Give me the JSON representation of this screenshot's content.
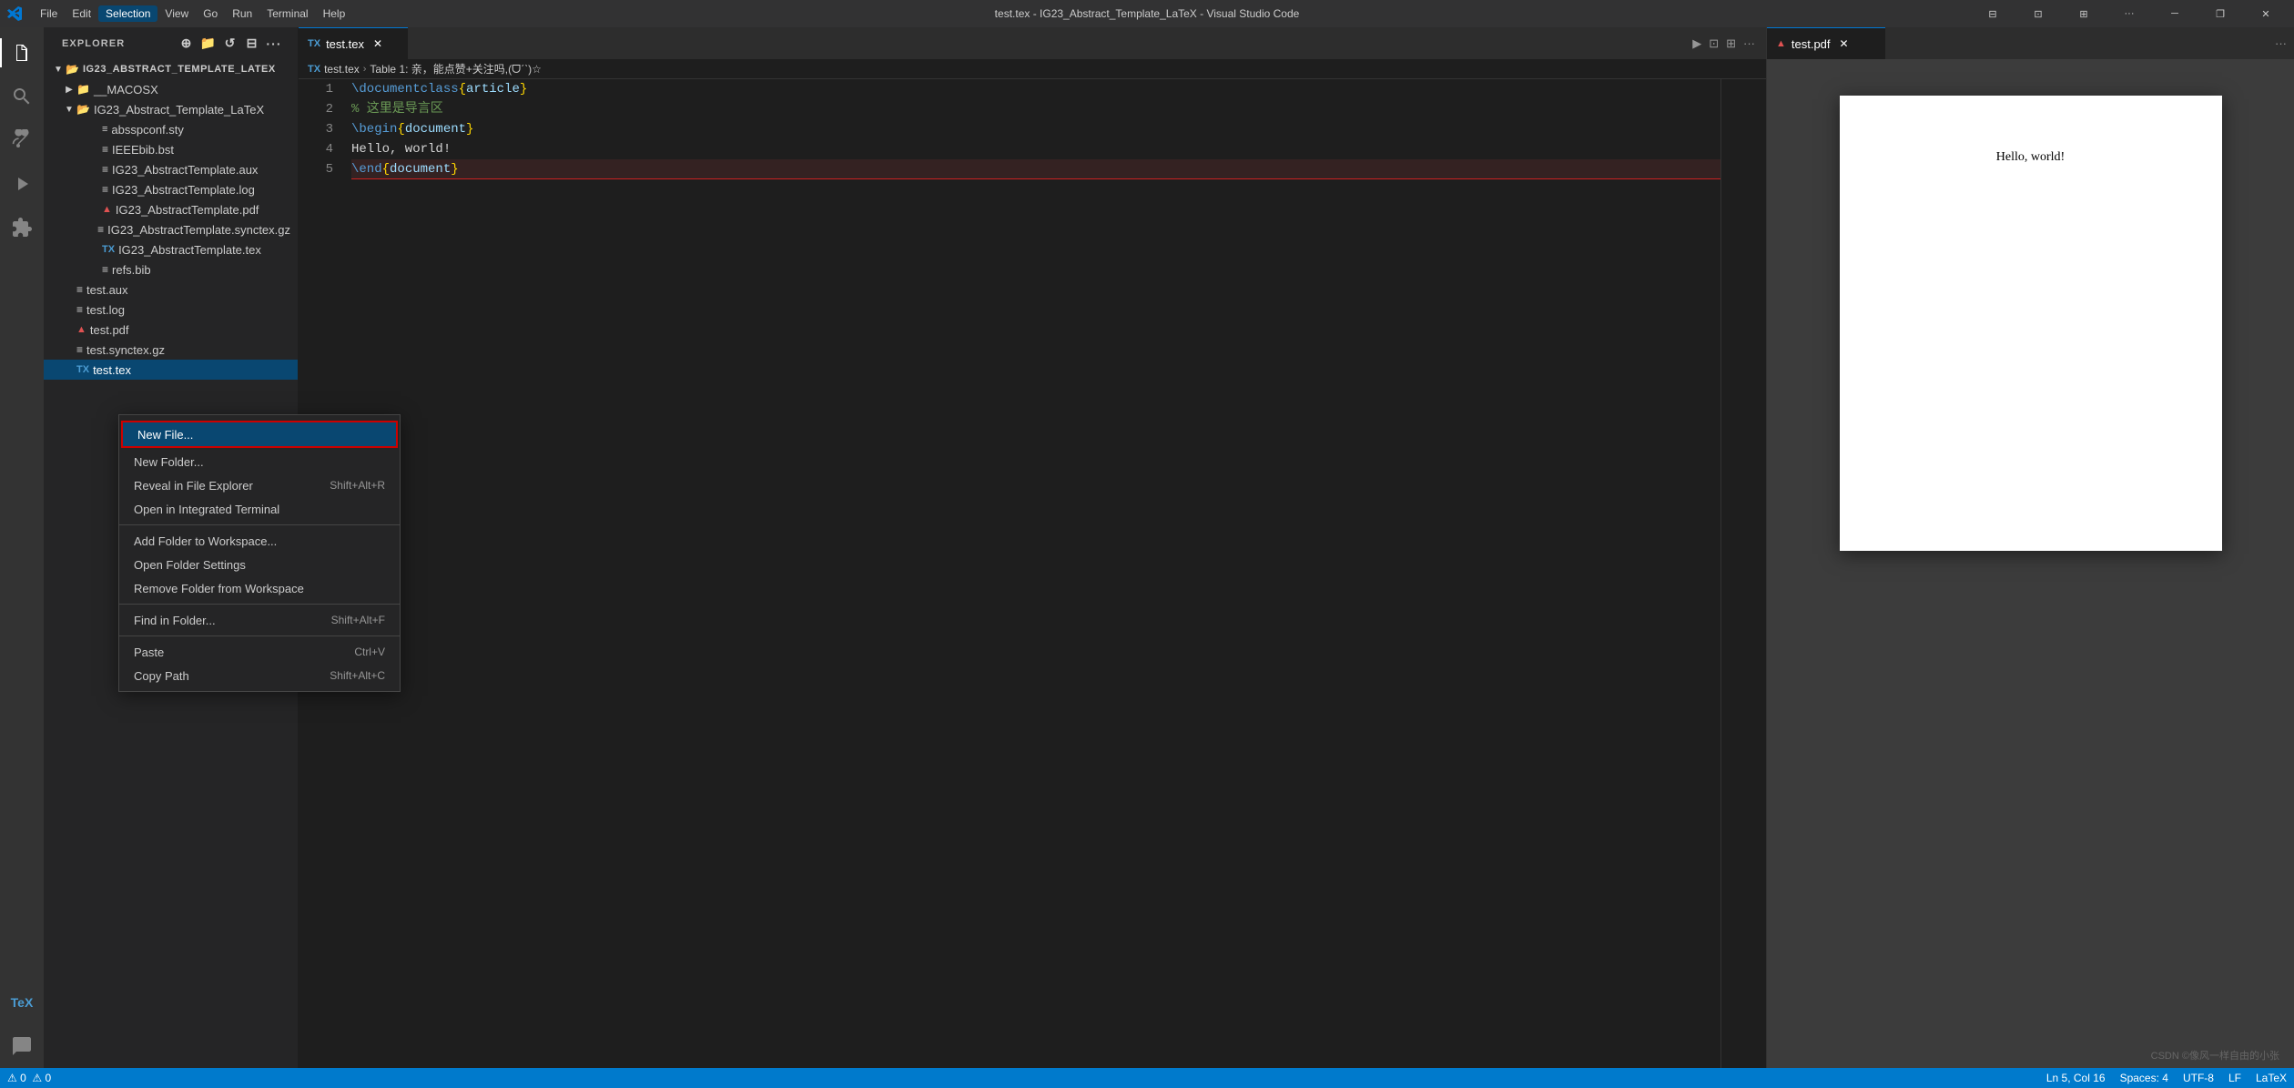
{
  "titleBar": {
    "title": "test.tex - IG23_Abstract_Template_LaTeX - Visual Studio Code",
    "menus": [
      "File",
      "Edit",
      "Selection",
      "View",
      "Go",
      "Run",
      "Terminal",
      "Help"
    ],
    "activeMenu": "Selection",
    "windowButtons": [
      "minimize",
      "maximize",
      "restore",
      "close"
    ]
  },
  "activityBar": {
    "icons": [
      {
        "name": "explorer-icon",
        "symbol": "⎘",
        "active": true
      },
      {
        "name": "search-icon",
        "symbol": "🔍",
        "active": false
      },
      {
        "name": "source-control-icon",
        "symbol": "⎇",
        "active": false
      },
      {
        "name": "run-icon",
        "symbol": "▶",
        "active": false
      },
      {
        "name": "extensions-icon",
        "symbol": "⊞",
        "active": false
      },
      {
        "name": "tex-icon",
        "symbol": "T",
        "active": false
      },
      {
        "name": "pages-icon",
        "symbol": "☰",
        "active": false
      }
    ]
  },
  "sidebar": {
    "title": "EXPLORER",
    "rootFolder": "IG23_ABSTRACT_TEMPLATE_LATEX",
    "tree": [
      {
        "id": "macosx",
        "label": "__MACOSX",
        "type": "folder",
        "indent": 1,
        "expanded": false
      },
      {
        "id": "ig23folder",
        "label": "IG23_Abstract_Template_LaTeX",
        "type": "folder",
        "indent": 1,
        "expanded": true
      },
      {
        "id": "absspconf",
        "label": "absspconf.sty",
        "type": "file-sty",
        "indent": 2
      },
      {
        "id": "ieeebib",
        "label": "IEEEbib.bst",
        "type": "file",
        "indent": 2
      },
      {
        "id": "ig23aux",
        "label": "IG23_AbstractTemplate.aux",
        "type": "file",
        "indent": 2
      },
      {
        "id": "ig23log",
        "label": "IG23_AbstractTemplate.log",
        "type": "file",
        "indent": 2
      },
      {
        "id": "ig23pdf",
        "label": "IG23_AbstractTemplate.pdf",
        "type": "file-pdf",
        "indent": 2
      },
      {
        "id": "ig23synctex",
        "label": "IG23_AbstractTemplate.synctex.gz",
        "type": "file",
        "indent": 2
      },
      {
        "id": "ig23tex",
        "label": "IG23_AbstractTemplate.tex",
        "type": "file-tex",
        "indent": 2
      },
      {
        "id": "refsbib",
        "label": "refs.bib",
        "type": "file",
        "indent": 2
      },
      {
        "id": "testaux",
        "label": "test.aux",
        "type": "file",
        "indent": 1
      },
      {
        "id": "testlog",
        "label": "test.log",
        "type": "file",
        "indent": 1
      },
      {
        "id": "testpdf",
        "label": "test.pdf",
        "type": "file-pdf",
        "indent": 1
      },
      {
        "id": "testsynctex",
        "label": "test.synctex.gz",
        "type": "file",
        "indent": 1
      },
      {
        "id": "testtex",
        "label": "test.tex",
        "type": "file-tex",
        "indent": 1,
        "selected": true
      }
    ]
  },
  "editor": {
    "tab": "test.tex",
    "tabModified": true,
    "breadcrumb": [
      "test.tex",
      "Table 1: 亲，能点赞+关注吗,(ᗜˊˋ)☆"
    ],
    "lines": [
      {
        "num": 1,
        "tokens": [
          {
            "text": "\\documentclass",
            "class": "kw-cmd"
          },
          {
            "text": "{",
            "class": "kw-brace"
          },
          {
            "text": "article",
            "class": "kw-doc"
          },
          {
            "text": "}",
            "class": "kw-brace"
          }
        ]
      },
      {
        "num": 2,
        "tokens": [
          {
            "text": "% 这里是导言区",
            "class": "kw-comment"
          }
        ]
      },
      {
        "num": 3,
        "tokens": [
          {
            "text": "\\begin",
            "class": "kw-cmd"
          },
          {
            "text": "{",
            "class": "kw-brace"
          },
          {
            "text": "document",
            "class": "kw-doc"
          },
          {
            "text": "}",
            "class": "kw-brace"
          }
        ]
      },
      {
        "num": 4,
        "tokens": [
          {
            "text": "Hello, world!",
            "class": "kw-text"
          }
        ]
      },
      {
        "num": 5,
        "tokens": [
          {
            "text": "\\end",
            "class": "kw-cmd"
          },
          {
            "text": "{",
            "class": "kw-brace"
          },
          {
            "text": "document",
            "class": "kw-doc"
          },
          {
            "text": "}",
            "class": "kw-brace"
          }
        ],
        "error": true
      }
    ]
  },
  "preview": {
    "tab": "test.pdf",
    "content": "Hello, world!"
  },
  "contextMenu": {
    "items": [
      {
        "id": "new-file",
        "label": "New File...",
        "shortcut": "",
        "highlighted": true,
        "separator_after": false
      },
      {
        "id": "new-folder",
        "label": "New Folder...",
        "shortcut": "",
        "highlighted": false,
        "separator_after": false
      },
      {
        "id": "reveal-in-explorer",
        "label": "Reveal in File Explorer",
        "shortcut": "Shift+Alt+R",
        "highlighted": false,
        "separator_after": false
      },
      {
        "id": "open-terminal",
        "label": "Open in Integrated Terminal",
        "shortcut": "",
        "highlighted": false,
        "separator_after": true
      },
      {
        "id": "add-folder",
        "label": "Add Folder to Workspace...",
        "shortcut": "",
        "highlighted": false,
        "separator_after": false
      },
      {
        "id": "open-folder-settings",
        "label": "Open Folder Settings",
        "shortcut": "",
        "highlighted": false,
        "separator_after": false
      },
      {
        "id": "remove-folder",
        "label": "Remove Folder from Workspace",
        "shortcut": "",
        "highlighted": false,
        "separator_after": true
      },
      {
        "id": "find-in-folder",
        "label": "Find in Folder...",
        "shortcut": "Shift+Alt+F",
        "highlighted": false,
        "separator_after": true
      },
      {
        "id": "paste",
        "label": "Paste",
        "shortcut": "Ctrl+V",
        "highlighted": false,
        "disabled": false,
        "separator_after": false
      },
      {
        "id": "copy-path",
        "label": "Copy Path",
        "shortcut": "Shift+Alt+C",
        "highlighted": false,
        "separator_after": false
      }
    ]
  },
  "watermark": "CSDN ©像风一样自由的小张",
  "statusBar": {
    "left": [
      "⚠ 0",
      "⚠ 0"
    ],
    "right": [
      "Ln 5, Col 16",
      "Spaces: 4",
      "UTF-8",
      "LF",
      "LaTeX"
    ]
  }
}
